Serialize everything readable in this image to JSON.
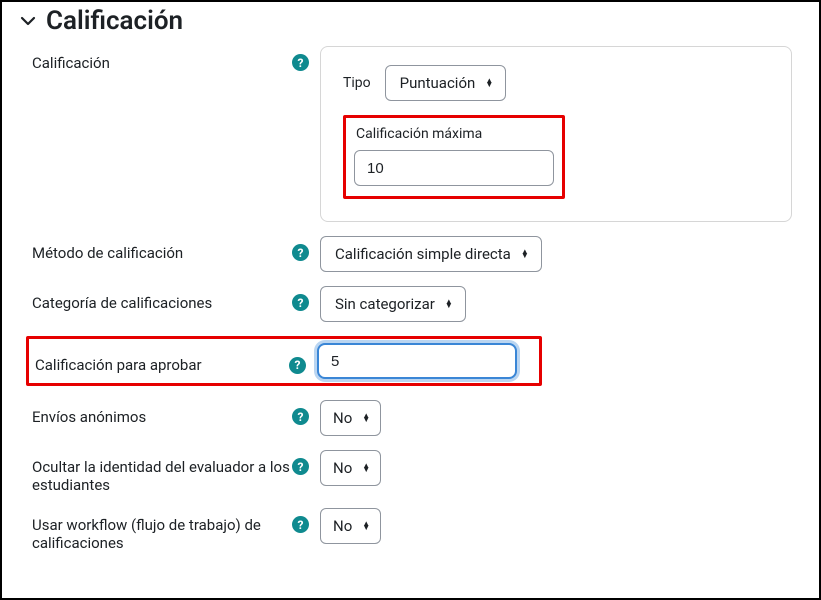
{
  "section": {
    "title": "Calificación"
  },
  "labels": {
    "grade": "Calificación",
    "tipo": "Tipo",
    "max_grade": "Calificación máxima",
    "grading_method": "Método de calificación",
    "grade_category": "Categoría de calificaciones",
    "grade_to_pass": "Calificación para aprobar",
    "anon": "Envíos anónimos",
    "hide_grader": "Ocultar la identidad del evaluador a los estudiantes",
    "workflow": "Usar workflow (flujo de trabajo) de calificaciones"
  },
  "values": {
    "tipo": "Puntuación",
    "max_grade": "10",
    "grading_method": "Calificación simple directa",
    "grade_category": "Sin categorizar",
    "grade_to_pass": "5",
    "anon": "No",
    "hide_grader": "No",
    "workflow": "No"
  }
}
